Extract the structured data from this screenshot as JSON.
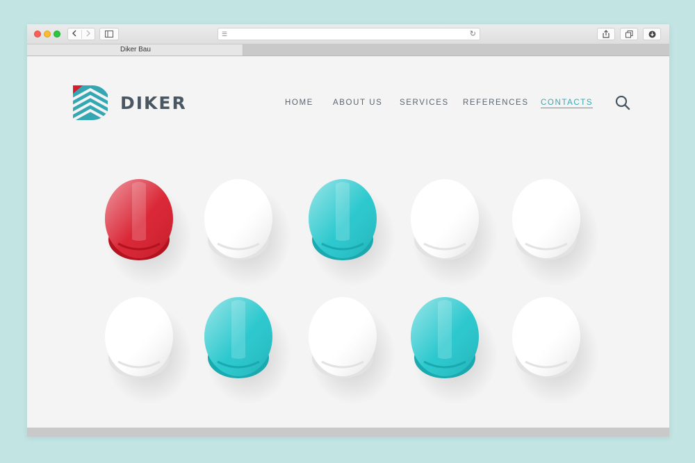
{
  "browser": {
    "tab_title": "Diker Bau",
    "back_icon": "chevron-left-icon",
    "forward_icon": "chevron-right-icon",
    "sidebar_icon": "sidebar-icon",
    "reader_icon": "reader-icon",
    "reload_icon": "reload-icon",
    "share_icon": "share-icon",
    "tabs_icon": "tabs-icon",
    "download_icon": "download-icon"
  },
  "site": {
    "brand": "DIKER",
    "nav": [
      {
        "label": "HOME",
        "active": false
      },
      {
        "label": "ABOUT US",
        "active": false
      },
      {
        "label": "SERVICES",
        "active": false
      },
      {
        "label": "REFERENCES",
        "active": false
      },
      {
        "label": "CONTACTS",
        "active": true
      }
    ],
    "search_icon": "search-icon"
  },
  "hero": {
    "helmet_colors": [
      [
        "#d81c2c",
        "#ffffff",
        "#22c6cc",
        "#ffffff",
        "#ffffff"
      ],
      [
        "#ffffff",
        "#22c6cc",
        "#ffffff",
        "#22c6cc",
        "#ffffff"
      ]
    ]
  },
  "colors": {
    "accent": "#35a7b3",
    "brand_red": "#d81c2c",
    "text": "#4a5763"
  }
}
